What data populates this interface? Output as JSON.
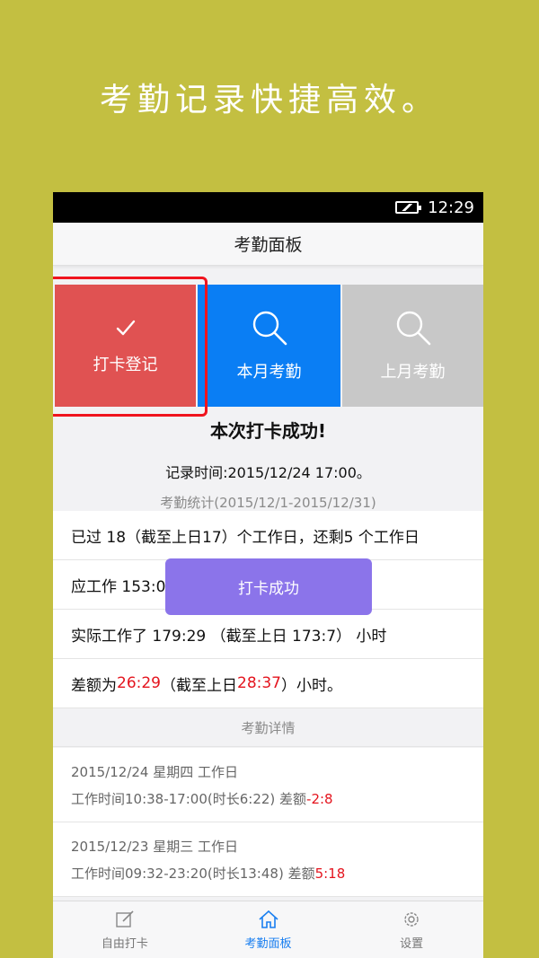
{
  "promo": {
    "text": "考勤记录快捷高效。"
  },
  "status_bar": {
    "time": "12:29",
    "icon": "battery-charging-icon"
  },
  "header": {
    "title": "考勤面板"
  },
  "tiles": [
    {
      "label": "打卡登记",
      "icon": "check-icon",
      "color": "#e05252"
    },
    {
      "label": "本月考勤",
      "icon": "search-icon",
      "color": "#0a7ef4"
    },
    {
      "label": "上月考勤",
      "icon": "search-icon",
      "color": "#c8c8c8"
    }
  ],
  "result": {
    "headline": "本次打卡成功!",
    "record_time": "记录时间:2015/12/24 17:00。",
    "stat_range": "考勤统计(2015/12/1-2015/12/31)"
  },
  "stats": {
    "row1": "已过 18（截至上日17）个工作日，还剩5 个工作日",
    "row2": "应工作 153:00",
    "row3": "实际工作了 179:29 （截至上日 173:7） 小时",
    "row4_prefix": "差额为 ",
    "row4_value1": "26:29",
    "row4_mid": " （截至上日",
    "row4_value2": "28:37",
    "row4_suffix": "）小时。"
  },
  "toast": {
    "text": "打卡成功"
  },
  "details": {
    "title": "考勤详情",
    "items": [
      {
        "date": "2015/12/24 星期四 工作日",
        "work": "工作时间10:38-17:00(时长6:22) 差额",
        "diff": "-2:8"
      },
      {
        "date": "2015/12/23 星期三 工作日",
        "work": "工作时间09:32-23:20(时长13:48) 差额",
        "diff": "5:18"
      }
    ]
  },
  "tabbar": {
    "items": [
      {
        "label": "自由打卡",
        "icon": "edit-icon"
      },
      {
        "label": "考勤面板",
        "icon": "home-icon",
        "active": true
      },
      {
        "label": "设置",
        "icon": "gear-icon"
      }
    ]
  },
  "colors": {
    "background": "#c3bf41",
    "accent": "#1a7ff0",
    "negative": "#e4141e",
    "toast": "#8b74ea"
  }
}
